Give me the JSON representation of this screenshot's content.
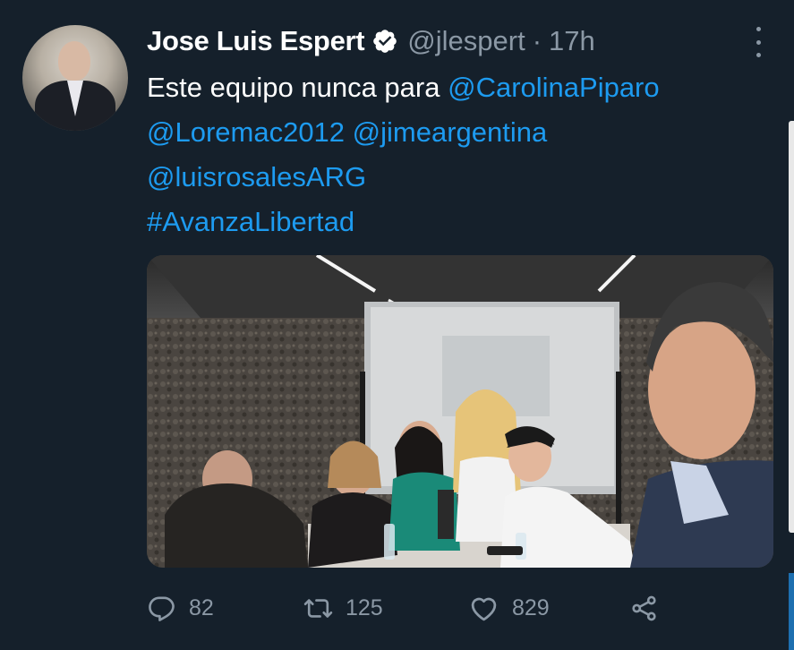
{
  "tweet": {
    "author_name": "Jose Luis Espert",
    "handle": "@jlespert",
    "separator": "·",
    "time": "17h",
    "text_parts": [
      {
        "text": "Este equipo nunca para ",
        "type": "plain"
      },
      {
        "text": "@CarolinaPiparo",
        "type": "mention"
      },
      {
        "text": "@Loremac2012",
        "type": "mention"
      },
      {
        "text": "@jimeargentina",
        "type": "mention"
      },
      {
        "text": "@luisrosalesARG",
        "type": "mention"
      },
      {
        "text": "#AvanzaLibertad",
        "type": "hashtag"
      }
    ],
    "replies": "82",
    "retweets": "125",
    "likes": "829"
  },
  "icons": {
    "verified": "verified-badge-icon",
    "more": "more-options-icon",
    "reply": "reply-icon",
    "retweet": "retweet-icon",
    "like": "heart-icon",
    "share": "share-icon"
  },
  "colors": {
    "background": "#15202b",
    "link": "#1d9bf0",
    "secondary_text": "#8b98a5",
    "primary_text": "#ffffff"
  }
}
